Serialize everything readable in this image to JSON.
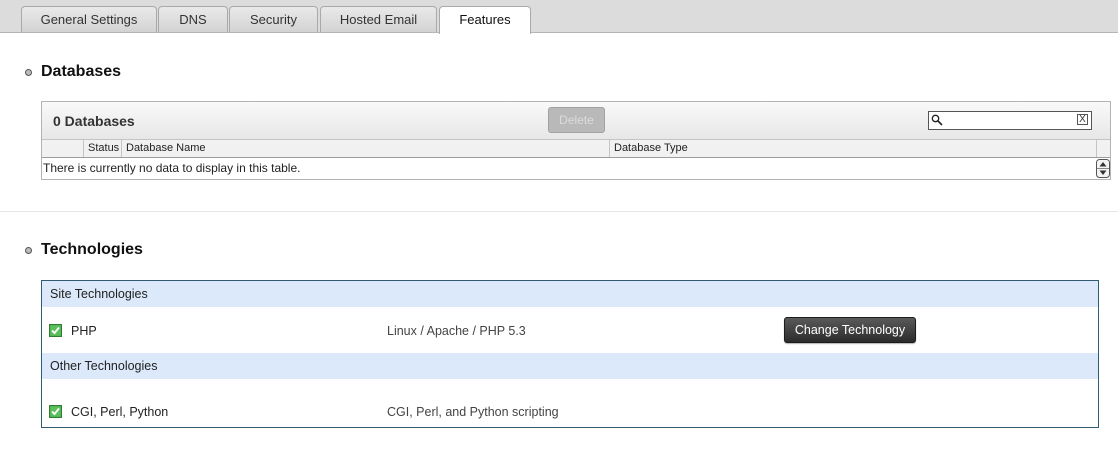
{
  "tabs": [
    {
      "label": "General Settings"
    },
    {
      "label": "DNS"
    },
    {
      "label": "Security"
    },
    {
      "label": "Hosted Email"
    },
    {
      "label": "Features"
    }
  ],
  "active_tab": "Features",
  "databases": {
    "title": "Databases",
    "count_label": "0 Databases",
    "delete_label": "Delete",
    "search_value": "",
    "clear_glyph": "X",
    "columns": [
      "Status",
      "Database Name",
      "Database Type"
    ],
    "empty_message": "There is currently no data to display in this table."
  },
  "technologies": {
    "title": "Technologies",
    "site_group_label": "Site Technologies",
    "other_group_label": "Other Technologies",
    "site": [
      {
        "name": "PHP",
        "description": "Linux / Apache / PHP 5.3",
        "enabled": true,
        "action_label": "Change Technology"
      }
    ],
    "other": [
      {
        "name": "CGI, Perl, Python",
        "description": "CGI, Perl, and Python scripting",
        "enabled": true
      }
    ]
  },
  "icons": {
    "search": "search-icon",
    "clear": "close-icon",
    "check": "checkbox-checked-icon",
    "bullet": "bullet-icon",
    "scroll": "scroll-arrows-icon"
  },
  "colors": {
    "group_header_bg": "#dbe9fa",
    "panel_border": "#2f5b73",
    "check_green": "#3a9a3a",
    "button_dark": "#2b2b2b"
  }
}
